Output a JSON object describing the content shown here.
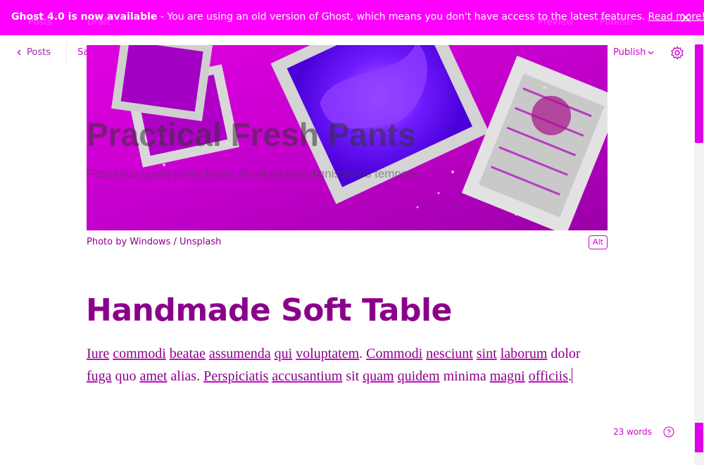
{
  "banner": {
    "title": "Ghost 4.0 is now available",
    "message": " - You are using an old version of Ghost, which means you don't have access to the latest features. ",
    "link": "Read more!",
    "ghost_left": "Posts",
    "ghost_status": "Draft",
    "ghost_preview": "Preview",
    "ghost_publish": "Publish"
  },
  "header": {
    "back_label": "Posts",
    "status": "Sa",
    "publish_label": "Publish"
  },
  "feature_image": {
    "overlay_title": "Practical Fresh Pants",
    "overlay_subtitle": "Possimus quasi porro facilis Illo doloribus dignissimos tempore.",
    "caption_prefix": "Photo by ",
    "caption_author": "Windows",
    "caption_sep": " / ",
    "caption_source": "Unsplash",
    "alt_label": "Alt"
  },
  "post": {
    "title": "Handmade Soft Table",
    "body_words": [
      {
        "t": "Iure",
        "s": true
      },
      {
        "t": " ",
        "s": false
      },
      {
        "t": "commodi",
        "s": true
      },
      {
        "t": " ",
        "s": false
      },
      {
        "t": "beatae",
        "s": true
      },
      {
        "t": " ",
        "s": false
      },
      {
        "t": "assumenda",
        "s": true
      },
      {
        "t": " ",
        "s": false
      },
      {
        "t": "qui",
        "s": true
      },
      {
        "t": " ",
        "s": false
      },
      {
        "t": "voluptatem",
        "s": true
      },
      {
        "t": ". ",
        "s": false
      },
      {
        "t": "Commodi",
        "s": true
      },
      {
        "t": " ",
        "s": false
      },
      {
        "t": "nesciunt",
        "s": true
      },
      {
        "t": " ",
        "s": false
      },
      {
        "t": "sint",
        "s": true
      },
      {
        "t": " ",
        "s": false
      },
      {
        "t": "laborum",
        "s": true
      },
      {
        "t": " dolor ",
        "s": false
      },
      {
        "t": "fuga",
        "s": true
      },
      {
        "t": " quo ",
        "s": false
      },
      {
        "t": "amet",
        "s": true
      },
      {
        "t": " alias. ",
        "s": false
      },
      {
        "t": "Perspiciatis",
        "s": true
      },
      {
        "t": " ",
        "s": false
      },
      {
        "t": "accusantium",
        "s": true
      },
      {
        "t": " sit ",
        "s": false
      },
      {
        "t": "quam",
        "s": true
      },
      {
        "t": " ",
        "s": false
      },
      {
        "t": "quidem",
        "s": true
      },
      {
        "t": " minima ",
        "s": false
      },
      {
        "t": "magni",
        "s": true
      },
      {
        "t": " ",
        "s": false
      },
      {
        "t": "officiis",
        "s": true
      },
      {
        "t": ".",
        "s": false
      }
    ]
  },
  "footer": {
    "word_count": "23 words"
  },
  "colors": {
    "accent": "#ff00ff",
    "text": "#8b008b",
    "link": "#c20cc5"
  },
  "icons": {
    "back": "chevron-left-icon",
    "publish": "chevron-down-icon",
    "settings": "gear-icon",
    "close": "close-icon",
    "help": "question-icon"
  }
}
